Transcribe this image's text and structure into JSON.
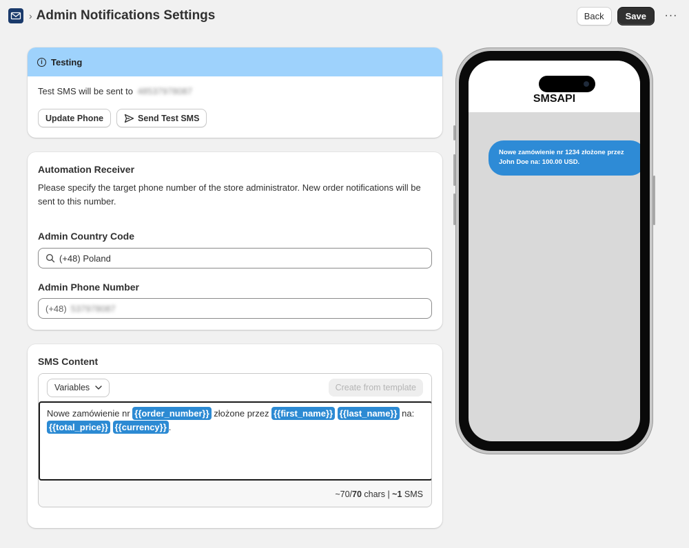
{
  "header": {
    "title": "Admin Notifications Settings",
    "breadcrumb_sep": "›",
    "back_label": "Back",
    "save_label": "Save",
    "more_label": "···"
  },
  "testing": {
    "title": "Testing",
    "info_glyph": "i",
    "sent_to_label": "Test SMS will be sent to",
    "sent_to_phone": "48537978087",
    "update_phone_label": "Update Phone",
    "send_test_label": "Send Test SMS"
  },
  "receiver": {
    "title": "Automation Receiver",
    "description": "Please specify the target phone number of the store administrator. New order notifications will be sent to this number.",
    "country_label": "Admin Country Code",
    "country_value": "(+48) Poland",
    "phone_label": "Admin Phone Number",
    "phone_prefix": "(+48)",
    "phone_value": "537978087"
  },
  "sms": {
    "title": "SMS Content",
    "variables_label": "Variables",
    "template_label": "Create from template",
    "content": {
      "t1": "Nowe zamówienie nr ",
      "v1": "{{order_number}}",
      "t2": " złożone przez ",
      "v2": "{{first_name}}",
      "t3": " ",
      "v3": "{{last_name}}",
      "t4": " na: ",
      "v4": "{{total_price}}",
      "t5": " ",
      "v5": "{{currency}}",
      "t6": "."
    },
    "counter": {
      "approx_prefix": "~70/",
      "chars_max": "70",
      "chars_suffix": " chars",
      "sep": " | ",
      "sms_count": "~1",
      "sms_suffix": " SMS"
    }
  },
  "preview": {
    "sender": "SMSAPI",
    "message": "Nowe zamówienie nr 1234 złożone przez John Doe na: 100.00 USD."
  },
  "colors": {
    "banner": "#9ed2fc",
    "accent": "#2c8ad3",
    "save_button": "#303030"
  }
}
